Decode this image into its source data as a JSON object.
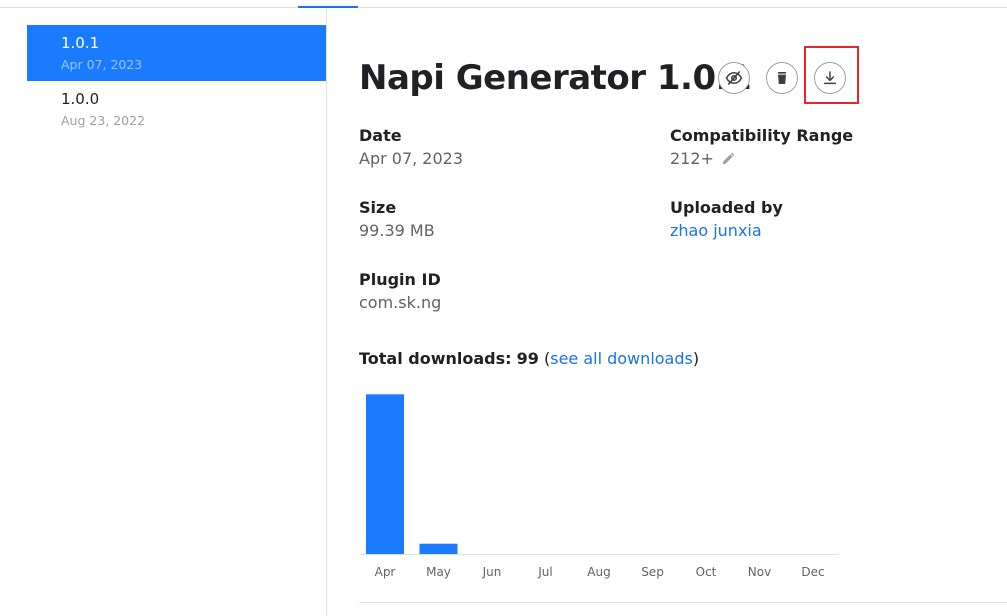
{
  "sidebar": {
    "versions": [
      {
        "version": "1.0.1",
        "date": "Apr 07, 2023",
        "selected": true
      },
      {
        "version": "1.0.0",
        "date": "Aug 23, 2022",
        "selected": false
      }
    ]
  },
  "header": {
    "title": "Napi Generator 1.0.1",
    "actions": [
      {
        "icon": "eye-off-icon",
        "label": "hide"
      },
      {
        "icon": "trash-icon",
        "label": "delete"
      },
      {
        "icon": "download-icon",
        "label": "download"
      }
    ]
  },
  "details": {
    "date_label": "Date",
    "date_value": "Apr 07, 2023",
    "compat_label": "Compatibility Range",
    "compat_value": "212+",
    "size_label": "Size",
    "size_value": "99.39 MB",
    "uploader_label": "Uploaded by",
    "uploader_value": "zhao junxia",
    "plugin_id_label": "Plugin ID",
    "plugin_id_value": "com.sk.ng"
  },
  "downloads": {
    "label": "Total downloads:",
    "count": "99",
    "open_paren": "(",
    "link_text": "see all downloads",
    "close_paren": ")"
  },
  "colors": {
    "accent": "#1a7bff",
    "link": "#1a73e8",
    "highlight": "#e5262a"
  },
  "chart_data": {
    "type": "bar",
    "categories": [
      "Apr",
      "May",
      "Jun",
      "Jul",
      "Aug",
      "Sep",
      "Oct",
      "Nov",
      "Dec"
    ],
    "values": [
      93,
      6,
      0,
      0,
      0,
      0,
      0,
      0,
      0
    ],
    "ylim": [
      0,
      99
    ],
    "grid": false,
    "color": "#1a7bff"
  }
}
